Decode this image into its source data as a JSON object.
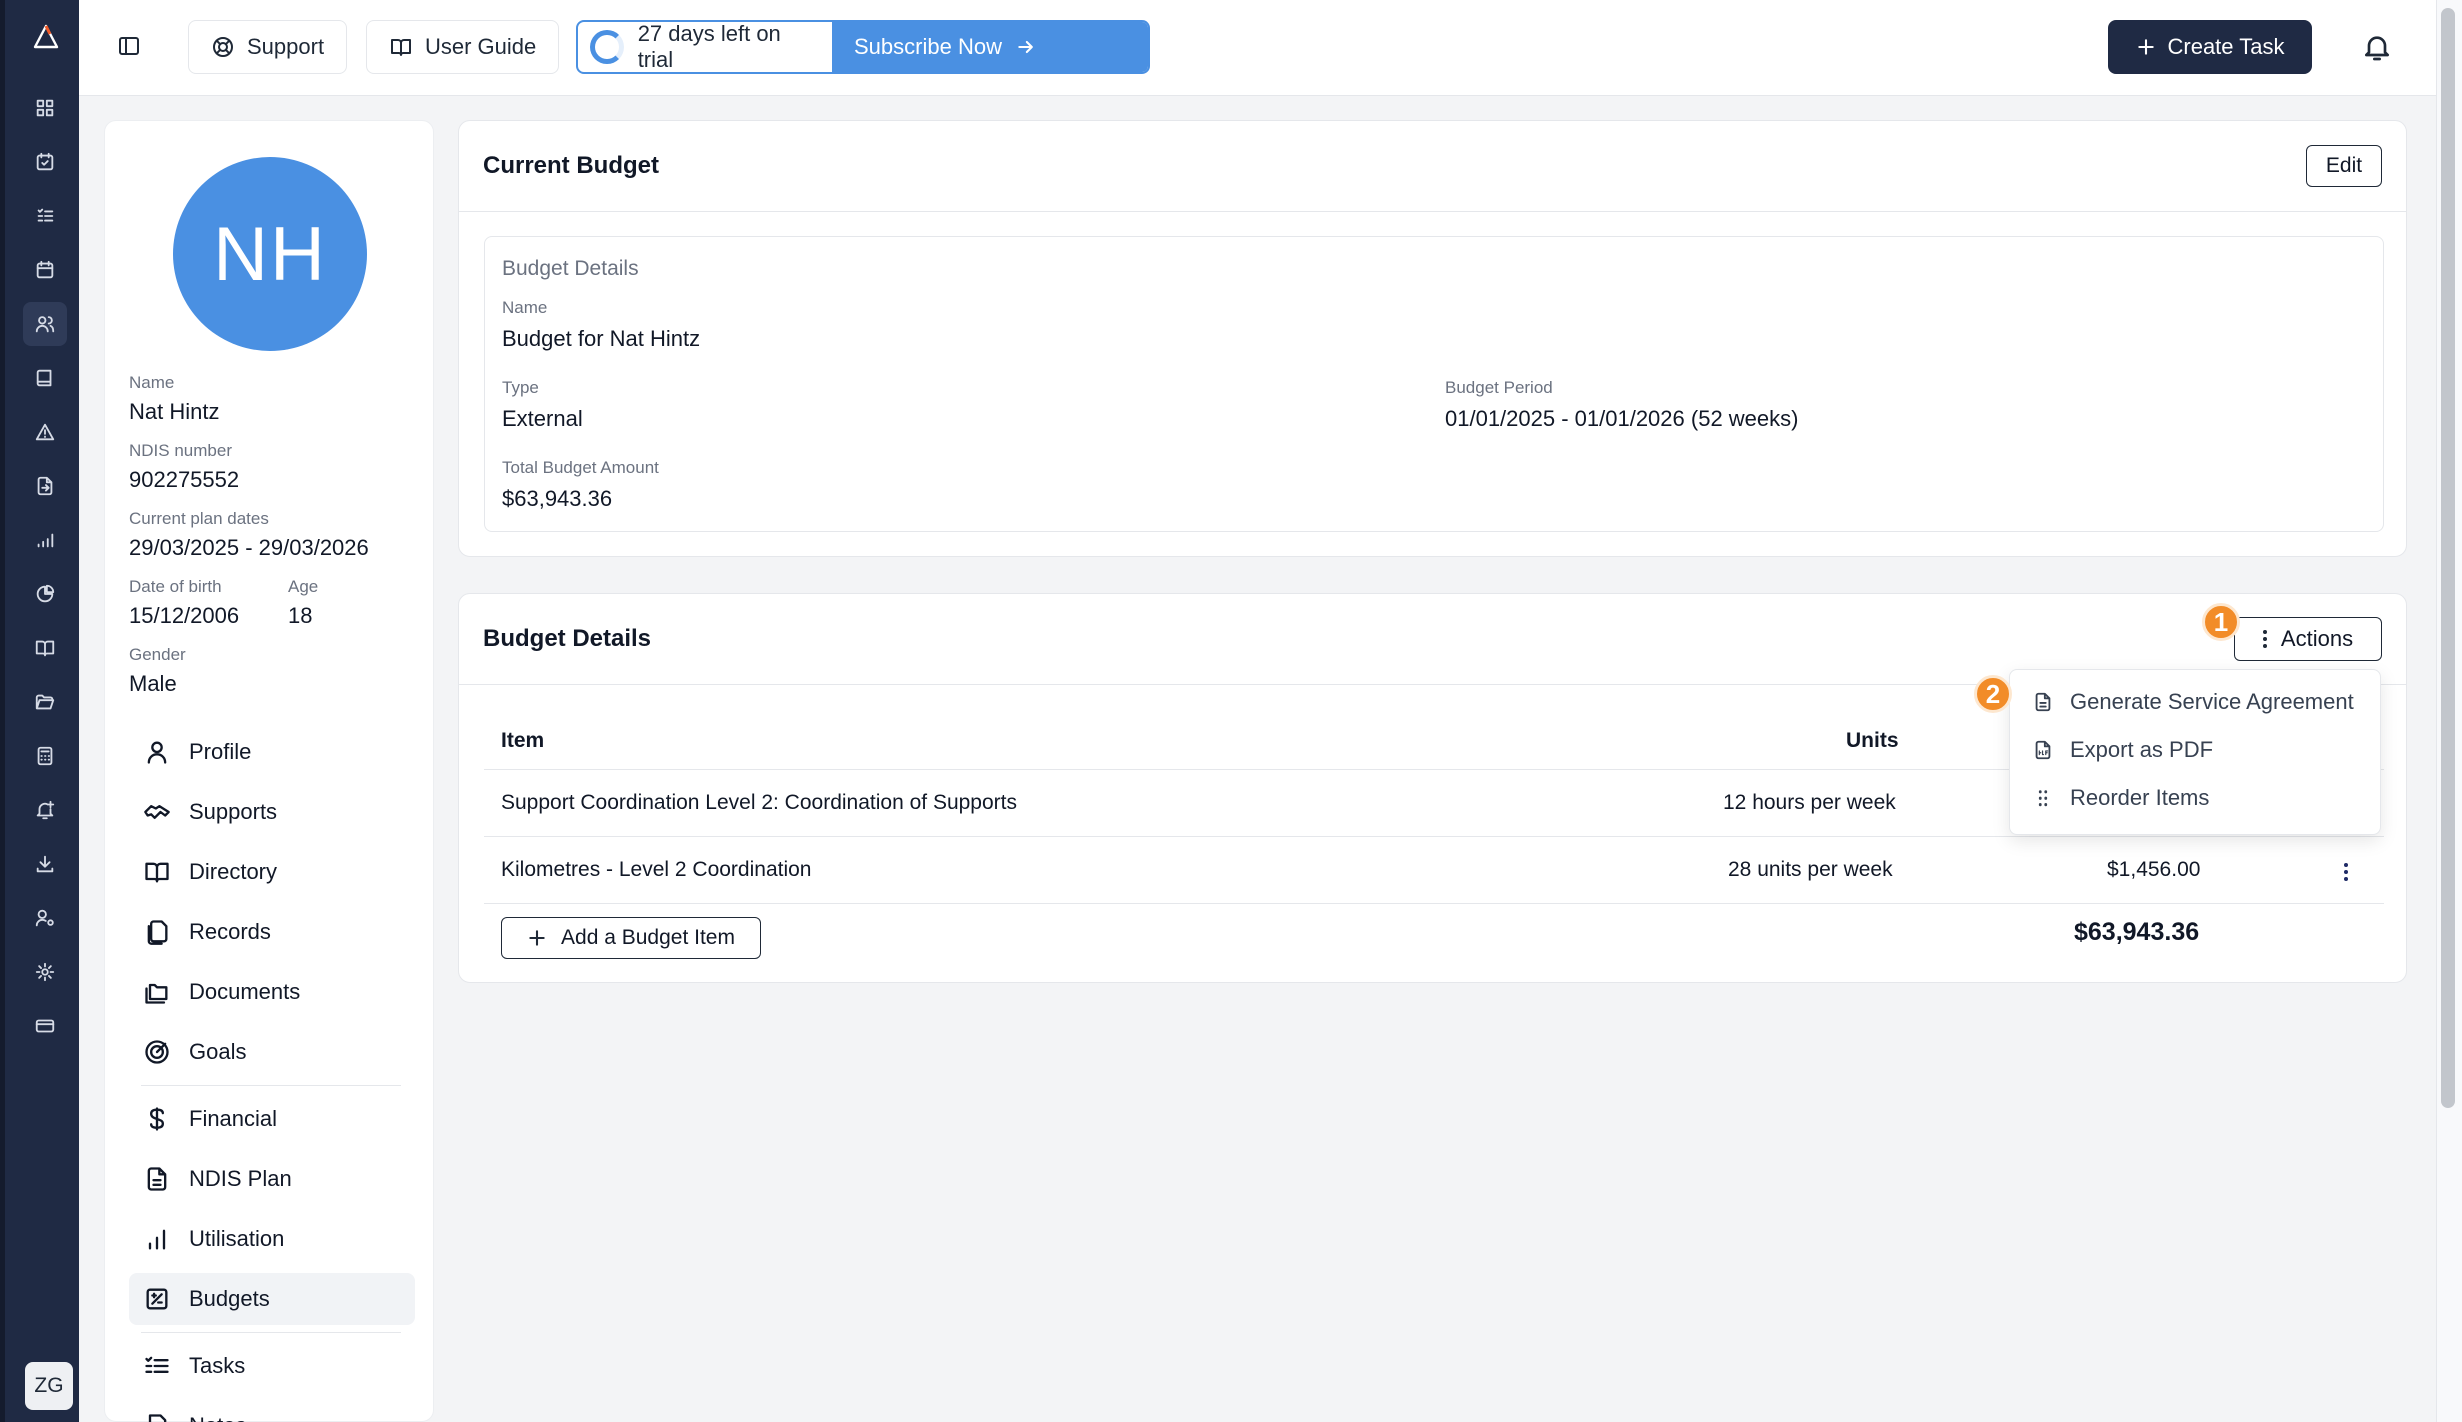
{
  "topbar": {
    "support_label": "Support",
    "user_guide_label": "User Guide",
    "trial_text": "27 days left on trial",
    "subscribe_label": "Subscribe Now",
    "create_task_label": "Create Task"
  },
  "rail": {
    "user_initials": "ZG",
    "icons": [
      "dashboard-icon",
      "calendar-check-icon",
      "list-icon",
      "calendar-icon",
      "users-icon",
      "book-icon",
      "alert-triangle-icon",
      "file-export-icon",
      "bar-chart-icon",
      "pie-chart-icon",
      "book-open-icon",
      "folder-open-icon",
      "calculator-icon",
      "bell-plus-icon",
      "download-icon",
      "user-cog-icon",
      "settings-icon",
      "credit-card-icon"
    ]
  },
  "profile": {
    "initials": "NH",
    "name_label": "Name",
    "name": "Nat Hintz",
    "ndis_label": "NDIS number",
    "ndis": "902275552",
    "plan_label": "Current plan dates",
    "plan_dates": "29/03/2025 - 29/03/2026",
    "dob_label": "Date of birth",
    "dob": "15/12/2006",
    "age_label": "Age",
    "age": "18",
    "gender_label": "Gender",
    "gender": "Male"
  },
  "nav": {
    "profile": "Profile",
    "supports": "Supports",
    "directory": "Directory",
    "records": "Records",
    "documents": "Documents",
    "goals": "Goals",
    "financial": "Financial",
    "ndis_plan": "NDIS Plan",
    "utilisation": "Utilisation",
    "budgets": "Budgets",
    "tasks": "Tasks",
    "notes": "Notes"
  },
  "current_budget": {
    "title": "Current Budget",
    "edit_label": "Edit",
    "section_title": "Budget Details",
    "name_label": "Name",
    "name": "Budget for Nat Hintz",
    "type_label": "Type",
    "type": "External",
    "period_label": "Budget Period",
    "period": "01/01/2025 - 01/01/2026 (52 weeks)",
    "total_label": "Total Budget Amount",
    "total": "$63,943.36"
  },
  "budget_details": {
    "title": "Budget Details",
    "actions_label": "Actions",
    "columns": {
      "item": "Item",
      "units": "Units"
    },
    "rows": [
      {
        "item": "Support Coordination Level 2: Coordination of Supports",
        "units": "12 hours per week",
        "amount": ""
      },
      {
        "item": "Kilometres - Level 2 Coordination",
        "units": "28 units per week",
        "amount": "$1,456.00"
      }
    ],
    "add_label": "Add a Budget Item",
    "grand_total": "$63,943.36"
  },
  "actions_menu": {
    "items": [
      "Generate Service Agreement",
      "Export as PDF",
      "Reorder Items"
    ]
  },
  "badges": {
    "one": "1",
    "two": "2"
  }
}
